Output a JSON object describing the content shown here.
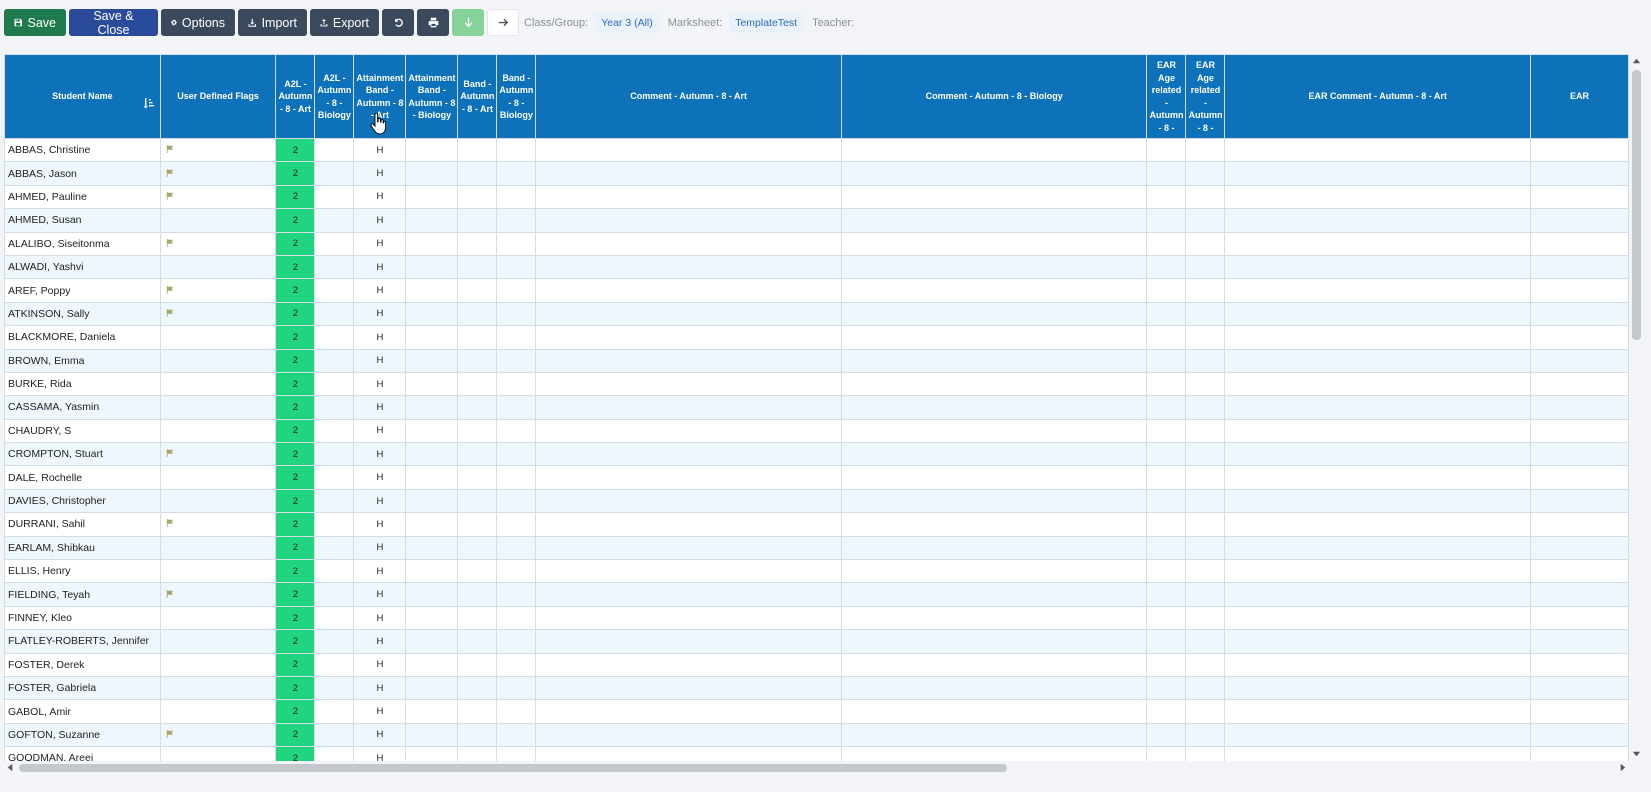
{
  "toolbar": {
    "save": "Save",
    "save_close": "Save & Close",
    "options": "Options",
    "import": "Import",
    "export": "Export",
    "class_group_label": "Class/Group:",
    "class_group_value": "Year 3 (All)",
    "marksheet_label": "Marksheet:",
    "marksheet_value": "TemplateTest",
    "teacher_label": "Teacher:"
  },
  "columns": [
    "Student Name",
    "User Defined Flags",
    "A2L - Autumn - 8 - Art",
    "A2L - Autumn - 8 - Biology",
    "Attainment Band - Autumn - 8 - Art",
    "Attainment Band - Autumn - 8 - Biology",
    "Band - Autumn - 8 - Art",
    "Band - Autumn - 8 - Biology",
    "Comment - Autumn - 8 - Art",
    "Comment - Autumn - 8 - Biology",
    "EAR Age related - Autumn - 8 -",
    "EAR Age related - Autumn - 8 -",
    "EAR Comment - Autumn - 8 - Art",
    "EAR"
  ],
  "rows": [
    {
      "name": "ABBAS, Christine",
      "flag": true,
      "a2l": "2",
      "band": "H"
    },
    {
      "name": "ABBAS, Jason",
      "flag": true,
      "a2l": "2",
      "band": "H"
    },
    {
      "name": "AHMED, Pauline",
      "flag": true,
      "a2l": "2",
      "band": "H"
    },
    {
      "name": "AHMED, Susan",
      "flag": false,
      "a2l": "2",
      "band": "H"
    },
    {
      "name": "ALALIBO, Siseitonma",
      "flag": true,
      "a2l": "2",
      "band": "H"
    },
    {
      "name": "ALWADI, Yashvi",
      "flag": false,
      "a2l": "2",
      "band": "H"
    },
    {
      "name": "AREF, Poppy",
      "flag": true,
      "a2l": "2",
      "band": "H"
    },
    {
      "name": "ATKINSON, Sally",
      "flag": true,
      "a2l": "2",
      "band": "H"
    },
    {
      "name": "BLACKMORE, Daniela",
      "flag": false,
      "a2l": "2",
      "band": "H"
    },
    {
      "name": "BROWN, Emma",
      "flag": false,
      "a2l": "2",
      "band": "H"
    },
    {
      "name": "BURKE, Rida",
      "flag": false,
      "a2l": "2",
      "band": "H"
    },
    {
      "name": "CASSAMA, Yasmin",
      "flag": false,
      "a2l": "2",
      "band": "H"
    },
    {
      "name": "CHAUDRY, S",
      "flag": false,
      "a2l": "2",
      "band": "H"
    },
    {
      "name": "CROMPTON, Stuart",
      "flag": true,
      "a2l": "2",
      "band": "H"
    },
    {
      "name": "DALE, Rochelle",
      "flag": false,
      "a2l": "2",
      "band": "H"
    },
    {
      "name": "DAVIES, Christopher",
      "flag": false,
      "a2l": "2",
      "band": "H"
    },
    {
      "name": "DURRANI, Sahil",
      "flag": true,
      "a2l": "2",
      "band": "H"
    },
    {
      "name": "EARLAM, Shibkau",
      "flag": false,
      "a2l": "2",
      "band": "H"
    },
    {
      "name": "ELLIS, Henry",
      "flag": false,
      "a2l": "2",
      "band": "H"
    },
    {
      "name": "FIELDING, Teyah",
      "flag": true,
      "a2l": "2",
      "band": "H"
    },
    {
      "name": "FINNEY, Kleo",
      "flag": false,
      "a2l": "2",
      "band": "H"
    },
    {
      "name": "FLATLEY-ROBERTS, Jennifer",
      "flag": false,
      "a2l": "2",
      "band": "H"
    },
    {
      "name": "FOSTER, Derek",
      "flag": false,
      "a2l": "2",
      "band": "H"
    },
    {
      "name": "FOSTER, Gabriela",
      "flag": false,
      "a2l": "2",
      "band": "H"
    },
    {
      "name": "GABOL, Amir",
      "flag": false,
      "a2l": "2",
      "band": "H"
    },
    {
      "name": "GOFTON, Suzanne",
      "flag": true,
      "a2l": "2",
      "band": "H"
    },
    {
      "name": "GOODMAN, Areej",
      "flag": false,
      "a2l": "2",
      "band": "H"
    }
  ]
}
